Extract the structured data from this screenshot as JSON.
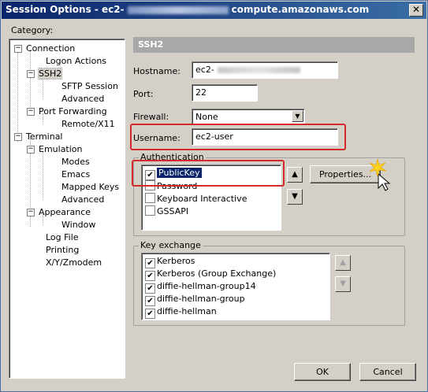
{
  "window": {
    "title_prefix": "Session Options - ec2-",
    "title_suffix": "compute.amazonaws.com",
    "close_glyph": "✕"
  },
  "category": {
    "label": "Category:",
    "tree": [
      {
        "label": "Connection",
        "expander": "−"
      },
      {
        "label": "Logon Actions"
      },
      {
        "label": "SSH2",
        "expander": "−",
        "selected": true
      },
      {
        "label": "SFTP Session"
      },
      {
        "label": "Advanced"
      },
      {
        "label": "Port Forwarding",
        "expander": "−"
      },
      {
        "label": "Remote/X11"
      },
      {
        "label": "Terminal",
        "expander": "−"
      },
      {
        "label": "Emulation",
        "expander": "−"
      },
      {
        "label": "Modes"
      },
      {
        "label": "Emacs"
      },
      {
        "label": "Mapped Keys"
      },
      {
        "label": "Advanced"
      },
      {
        "label": "Appearance",
        "expander": "−"
      },
      {
        "label": "Window"
      },
      {
        "label": "Log File"
      },
      {
        "label": "Printing"
      },
      {
        "label": "X/Y/Zmodem"
      }
    ]
  },
  "ssh2": {
    "header": "SSH2",
    "hostname_label": "Hostname:",
    "hostname_value": "ec2-",
    "port_label": "Port:",
    "port_value": "22",
    "firewall_label": "Firewall:",
    "firewall_value": "None",
    "username_label": "Username:",
    "username_value": "ec2-user",
    "authentication": {
      "title": "Authentication",
      "items": [
        {
          "label": "PublicKey",
          "checked": true
        },
        {
          "label": "Password",
          "checked": false
        },
        {
          "label": "Keyboard Interactive",
          "checked": false
        },
        {
          "label": "GSSAPI",
          "checked": false
        }
      ],
      "properties_label": "Properties..."
    },
    "key_exchange": {
      "title": "Key exchange",
      "items": [
        {
          "label": "Kerberos",
          "checked": true
        },
        {
          "label": "Kerberos (Group Exchange)",
          "checked": true
        },
        {
          "label": "diffie-hellman-group14",
          "checked": true
        },
        {
          "label": "diffie-hellman-group",
          "checked": true
        },
        {
          "label": "diffie-hellman",
          "checked": true
        }
      ]
    }
  },
  "footer": {
    "ok_label": "OK",
    "cancel_label": "Cancel"
  },
  "colors": {
    "titlebar": "#0a246a",
    "highlight_box": "#d42a2a",
    "selection": "#0a246a"
  },
  "icons": {
    "check": "✔",
    "arrow_up": "▲",
    "arrow_down": "▼"
  }
}
